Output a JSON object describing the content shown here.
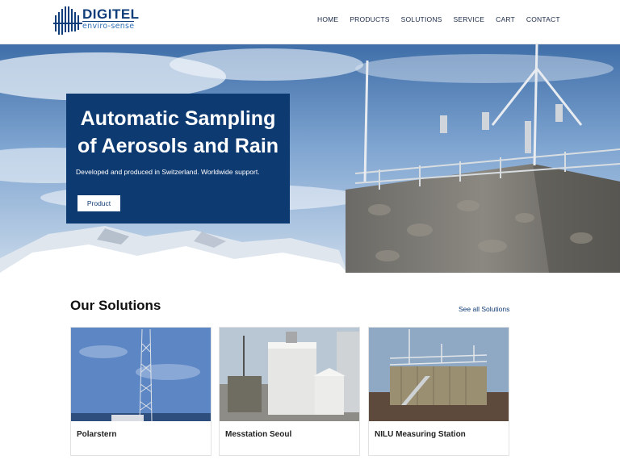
{
  "brand": {
    "name": "DIGITEL",
    "tagline": "enviro-sense"
  },
  "nav": {
    "items": [
      "HOME",
      "PRODUCTS",
      "SOLUTIONS",
      "SERVICE",
      "CART",
      "CONTACT"
    ]
  },
  "hero": {
    "title_line1": "Automatic Sampling",
    "title_line2": "of Aerosols and Rain",
    "subtitle": "Developed and produced in Switzerland. Worldwide support.",
    "button_label": "Product"
  },
  "solutions": {
    "heading": "Our Solutions",
    "see_all_label": "See all Solutions",
    "cards": [
      {
        "label": "Polarstern"
      },
      {
        "label": "Messtation Seoul"
      },
      {
        "label": "NILU Measuring Station"
      }
    ]
  },
  "colors": {
    "brand_blue": "#0e3a72",
    "accent_blue": "#2f6fb4"
  }
}
